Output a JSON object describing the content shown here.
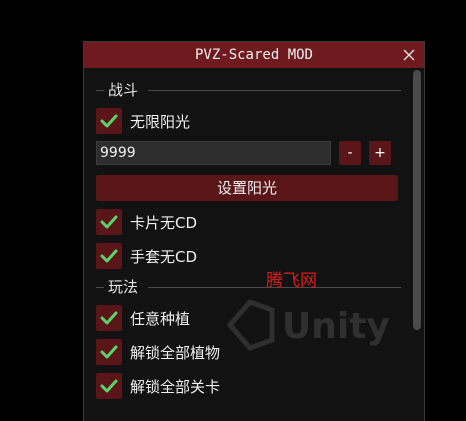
{
  "window": {
    "title": "PVZ-Scared MOD"
  },
  "sections": {
    "battle": "战斗",
    "gameplay": "玩法"
  },
  "battle": {
    "unlimited_sun_label": "无限阳光",
    "unlimited_sun_checked": true,
    "sun_input_value": "9999",
    "decrement_label": "-",
    "increment_label": "+",
    "set_sun_button_label": "设置阳光",
    "card_no_cd_label": "卡片无CD",
    "card_no_cd_checked": true,
    "glove_no_cd_label": "手套无CD",
    "glove_no_cd_checked": true
  },
  "gameplay": {
    "free_plant_label": "任意种植",
    "free_plant_checked": true,
    "unlock_plants_label": "解锁全部植物",
    "unlock_plants_checked": true,
    "unlock_levels_label": "解锁全部关卡",
    "unlock_levels_checked": true
  },
  "overlay": {
    "watermark_text": "腾飞网",
    "unity_logo_text": "Unity"
  },
  "colors": {
    "title_bar": "#6e1a1f",
    "button_bg": "#5a1519",
    "check_mark": "#5bd36b",
    "window_bg": "#121212",
    "watermark": "#d61e1e"
  }
}
